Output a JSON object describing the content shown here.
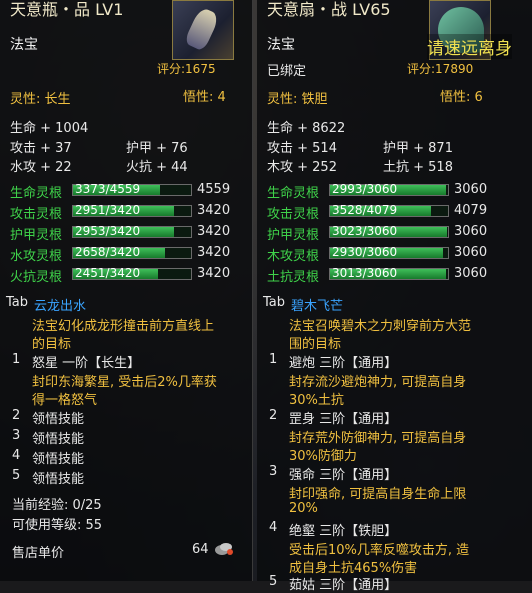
{
  "left": {
    "title": "天意瓶・品 LV1",
    "type": "法宝",
    "score": "评分:1675",
    "spirit_label": "灵性: 长生",
    "insight": "悟性: 4",
    "stats": [
      {
        "text": "生命 + 1004"
      },
      {
        "text": "攻击 + 37"
      },
      {
        "text": "护甲 + 76"
      },
      {
        "text": "水攻 + 22"
      },
      {
        "text": "火抗 + 44"
      }
    ],
    "roots": [
      {
        "label": "生命灵根",
        "value": "3373/4559",
        "max": "4559",
        "fraction": 0.74
      },
      {
        "label": "攻击灵根",
        "value": "2951/3420",
        "max": "3420",
        "fraction": 0.86
      },
      {
        "label": "护甲灵根",
        "value": "2953/3420",
        "max": "3420",
        "fraction": 0.86
      },
      {
        "label": "水攻灵根",
        "value": "2658/3420",
        "max": "3420",
        "fraction": 0.78
      },
      {
        "label": "火抗灵根",
        "value": "2451/3420",
        "max": "3420",
        "fraction": 0.72
      }
    ],
    "tab_label": "Tab",
    "skill_name": "云龙出水",
    "skill_desc": [
      "法宝幻化成龙形撞击前方直线上",
      "的目标"
    ],
    "subskills": [
      {
        "num": "1",
        "name": "怒星 一阶【长生】",
        "desc": [
          "封印东海繁星, 受击后2%几率获",
          "得一格怒气"
        ]
      },
      {
        "num": "2",
        "name": "领悟技能"
      },
      {
        "num": "3",
        "name": "领悟技能"
      },
      {
        "num": "4",
        "name": "领悟技能"
      },
      {
        "num": "5",
        "name": "领悟技能"
      }
    ],
    "exp": "当前经验:  0/25",
    "level": "可使用等级:  55",
    "price_label": "售店单价",
    "price": "64"
  },
  "right": {
    "title": "天意扇・战 LV65",
    "type": "法宝",
    "bound": "已绑定",
    "score": "评分:17890",
    "spirit_label": "灵性: 铁胆",
    "insight": "悟性: 6",
    "stats": [
      {
        "text": "生命 + 8622"
      },
      {
        "text": "攻击 + 514"
      },
      {
        "text": "护甲 + 871"
      },
      {
        "text": "木攻 + 252"
      },
      {
        "text": "土抗 + 518"
      }
    ],
    "roots": [
      {
        "label": "生命灵根",
        "value": "2993/3060",
        "max": "3060",
        "fraction": 0.98
      },
      {
        "label": "攻击灵根",
        "value": "3528/4079",
        "max": "4079",
        "fraction": 0.86
      },
      {
        "label": "护甲灵根",
        "value": "3023/3060",
        "max": "3060",
        "fraction": 0.99
      },
      {
        "label": "木攻灵根",
        "value": "2930/3060",
        "max": "3060",
        "fraction": 0.96
      },
      {
        "label": "土抗灵根",
        "value": "3013/3060",
        "max": "3060",
        "fraction": 0.98
      }
    ],
    "tab_label": "Tab",
    "skill_name": "碧木飞芒",
    "skill_desc": [
      "法宝召唤碧木之力刺穿前方大范",
      "围的目标"
    ],
    "subskills": [
      {
        "num": "1",
        "name": "避炮 三阶【通用】",
        "desc": [
          "封存流沙避炮神力, 可提高自身",
          "30%土抗"
        ]
      },
      {
        "num": "2",
        "name": "罡身 三阶【通用】",
        "desc": [
          "封存荒外防御神力, 可提高自身",
          "30%防御力"
        ]
      },
      {
        "num": "3",
        "name": "强命 三阶【通用】",
        "desc": [
          "封印强命, 可提高自身生命上限",
          "20%"
        ]
      },
      {
        "num": "4",
        "name": "绝壑 三阶【铁胆】",
        "desc": [
          "受击后10%几率反噬攻击方, 造",
          "成自身土抗465%伤害"
        ]
      },
      {
        "num": "5",
        "name": "茹姑 三阶【通用】"
      }
    ],
    "notice": "请速远离身"
  },
  "colors": {
    "accent": "#f0c040",
    "green": "#3fd24a",
    "skill": "#3aa4ff"
  }
}
